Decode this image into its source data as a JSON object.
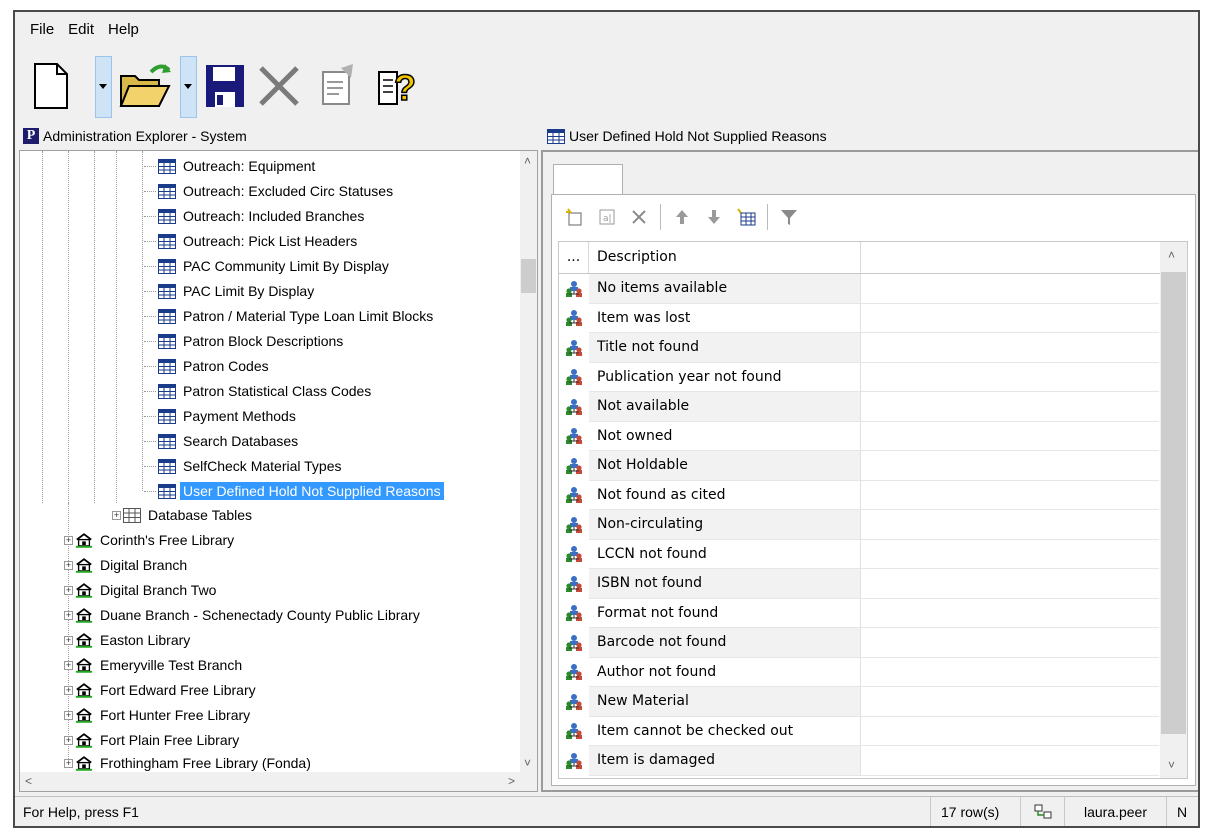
{
  "menu": {
    "file": "File",
    "edit": "Edit",
    "help": "Help"
  },
  "toolbar": {
    "icons": [
      "new-document-icon",
      "open-folder-icon",
      "save-disk-icon",
      "delete-x-icon",
      "properties-icon",
      "help-icon"
    ]
  },
  "left_pane": {
    "title": "Administration Explorer - System",
    "tree_items": [
      "Outreach: Equipment",
      "Outreach: Excluded Circ Statuses",
      "Outreach: Included Branches",
      "Outreach: Pick List Headers",
      "PAC Community Limit By Display",
      "PAC Limit By Display",
      "Patron / Material Type Loan Limit Blocks",
      "Patron Block Descriptions",
      "Patron Codes",
      "Patron Statistical Class Codes",
      "Payment Methods",
      "Search Databases",
      "SelfCheck Material Types",
      "User Defined Hold Not Supplied Reasons"
    ],
    "database_tables": "Database Tables",
    "branches": [
      "Corinth's Free Library",
      "Digital Branch",
      "Digital Branch Two",
      "Duane Branch - Schenectady County Public Library",
      "Easton Library",
      "Emeryville Test Branch",
      "Fort Edward Free Library",
      "Fort Hunter Free Library",
      "Fort Plain Free Library",
      "Frothingham Free Library (Fonda)"
    ]
  },
  "right_pane": {
    "title": "User Defined Hold Not Supplied Reasons",
    "grid": {
      "col_dots": "...",
      "col_description": "Description",
      "rows": [
        "No items available",
        "Item was lost",
        "Title not found",
        "Publication year not found",
        "Not available",
        "Not owned",
        "Not Holdable",
        "Not found as cited",
        "Non-circulating",
        "LCCN not found",
        "ISBN not found",
        "Format not found",
        "Barcode not found",
        "Author not found",
        "New Material",
        "Item cannot be checked out",
        "Item is damaged"
      ]
    }
  },
  "status": {
    "help": "For Help, press F1",
    "rows": "17 row(s)",
    "user": "laura.peer",
    "extra": "N"
  },
  "colors": {
    "selection": "#3399ff",
    "scroll_thumb": "#cdcdcd"
  }
}
